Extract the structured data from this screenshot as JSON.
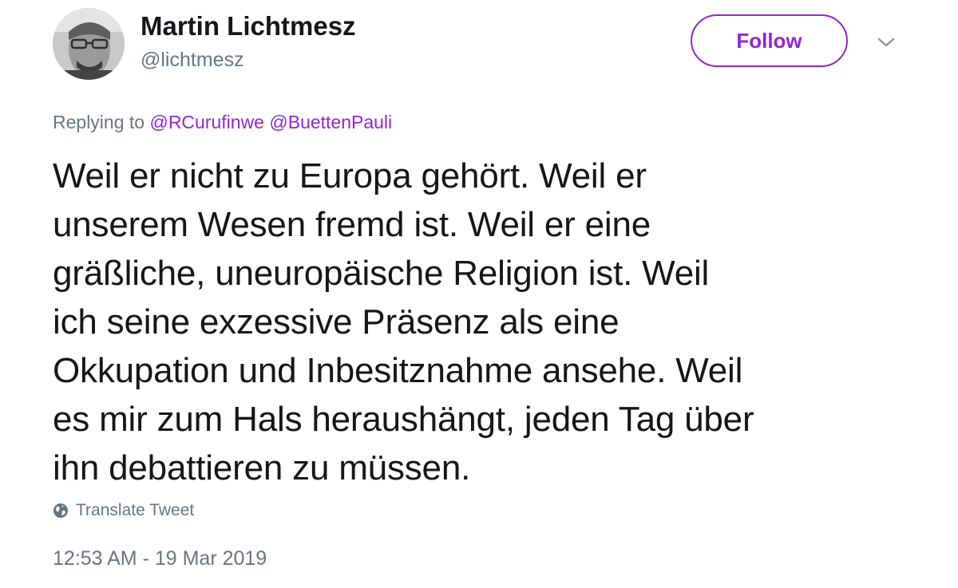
{
  "author": {
    "display_name": "Martin Lichtmesz",
    "handle": "@lichtmesz"
  },
  "follow_button": {
    "label": "Follow"
  },
  "reply_context": {
    "prefix": "Replying to",
    "mentions": [
      "@RCurufinwe",
      "@BuettenPauli"
    ]
  },
  "tweet": {
    "lines": [
      "Weil er nicht zu Europa gehört. Weil er",
      "unserem Wesen fremd ist. Weil er eine",
      "gräßliche, uneuropäische Religion ist. Weil",
      "ich seine exzessive Präsenz als eine",
      "Okkupation und Inbesitznahme ansehe. Weil",
      "es mir zum Hals heraushängt, jeden Tag über",
      "ihn debattieren zu müssen."
    ]
  },
  "translate": {
    "label": "Translate Tweet",
    "icon": "globe-icon"
  },
  "timestamp": "12:53 AM - 19 Mar 2019",
  "colors": {
    "accent": "#9327cf",
    "secondary_text": "#657786",
    "primary_text": "#14171a"
  }
}
